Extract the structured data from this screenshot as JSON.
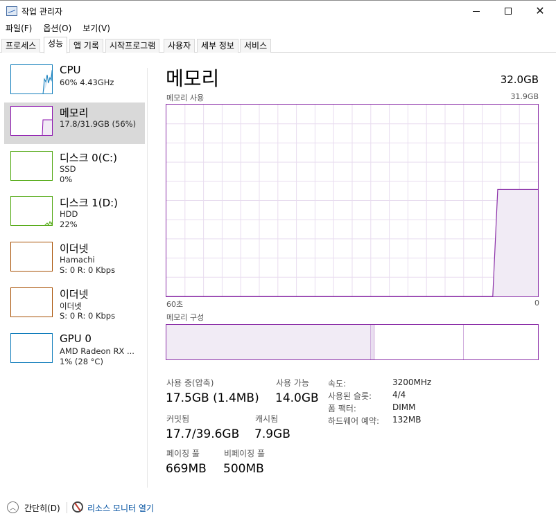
{
  "window": {
    "title": "작업 관리자"
  },
  "menu": [
    "파일(F)",
    "옵션(O)",
    "보기(V)"
  ],
  "tabs": [
    "프로세스",
    "성능",
    "앱 기록",
    "시작프로그램",
    "사용자",
    "세부 정보",
    "서비스"
  ],
  "active_tab": "성능",
  "sidebar": {
    "items": [
      {
        "title": "CPU",
        "sub1": "60% 4.43GHz",
        "sub2": "",
        "color": "#117dbb",
        "active": false
      },
      {
        "title": "메모리",
        "sub1": "17.8/31.9GB (56%)",
        "sub2": "",
        "color": "#8b12ae",
        "active": true
      },
      {
        "title": "디스크 0(C:)",
        "sub1": "SSD",
        "sub2": "0%",
        "color": "#4da60c",
        "active": false
      },
      {
        "title": "디스크 1(D:)",
        "sub1": "HDD",
        "sub2": "22%",
        "color": "#4da60c",
        "active": false
      },
      {
        "title": "이더넷",
        "sub1": "Hamachi",
        "sub2": "S: 0  R: 0 Kbps",
        "color": "#a74f01",
        "active": false
      },
      {
        "title": "이더넷",
        "sub1": "이더넷",
        "sub2": "S: 0  R: 0 Kbps",
        "color": "#a74f01",
        "active": false
      },
      {
        "title": "GPU 0",
        "sub1": "AMD Radeon RX ...",
        "sub2": "1% (28 °C)",
        "color": "#117dbb",
        "active": false
      }
    ]
  },
  "main": {
    "title": "메모리",
    "total": "32.0GB",
    "usage_label": "메모리 사용",
    "usage_max": "31.9GB",
    "axis_left": "60초",
    "axis_right": "0",
    "composition_label": "메모리 구성"
  },
  "stats": {
    "in_use_label": "사용 중(압축)",
    "in_use_value": "17.5GB (1.4MB)",
    "available_label": "사용 가능",
    "available_value": "14.0GB",
    "committed_label": "커밋됨",
    "committed_value": "17.7/39.6GB",
    "cached_label": "캐시됨",
    "cached_value": "7.9GB",
    "paged_label": "페이징 풀",
    "paged_value": "669MB",
    "nonpaged_label": "비페이징 풀",
    "nonpaged_value": "500MB"
  },
  "details": [
    {
      "label": "속도:",
      "value": "3200MHz"
    },
    {
      "label": "사용된 슬롯:",
      "value": "4/4"
    },
    {
      "label": "폼 팩터:",
      "value": "DIMM"
    },
    {
      "label": "하드웨어 예약:",
      "value": "132MB"
    }
  ],
  "footer": {
    "simple_label": "간단히(D)",
    "resource_monitor_label": "리소스 모니터 열기"
  },
  "chart_data": {
    "type": "area",
    "x_range": [
      60,
      0
    ],
    "ylim": [
      0,
      31.9
    ],
    "series": [
      {
        "x": [
          60,
          7.3,
          6.5,
          4.5,
          0
        ],
        "values": [
          0,
          0,
          17.8,
          17.8,
          17.8
        ]
      }
    ],
    "composition": {
      "in_use_fraction": 0.55,
      "modified_fraction": 0.01,
      "standby_fraction": 0.24,
      "free_fraction": 0.2
    },
    "colors": {
      "border": "#8b2fa8",
      "fill": "#f1ebf5",
      "grid": "#e8dcef"
    }
  }
}
